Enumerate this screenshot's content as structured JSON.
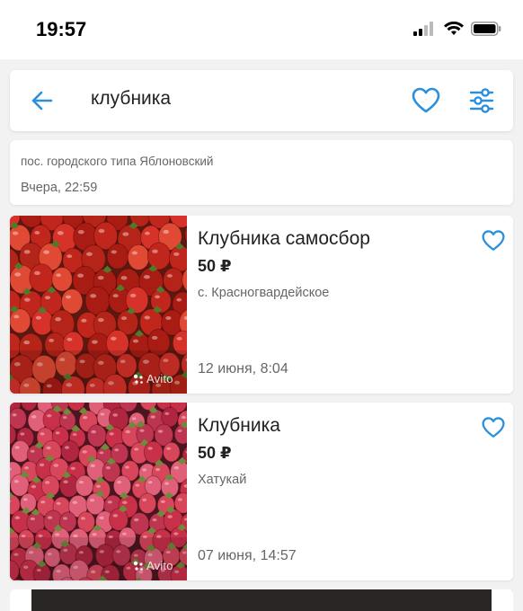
{
  "status_bar": {
    "time": "19:57"
  },
  "search": {
    "query": "клубника"
  },
  "info": {
    "location": "пос. городского типа Яблоновский",
    "date": "Вчера, 22:59"
  },
  "listings": [
    {
      "title": "Клубника самосбор",
      "price": "50 ₽",
      "place": "с. Красногвардейское",
      "date": "12 июня, 8:04",
      "watermark": "Avito"
    },
    {
      "title": "Клубника",
      "price": "50 ₽",
      "place": "Хатукай",
      "date": "07 июня, 14:57",
      "watermark": "Avito"
    }
  ],
  "colors": {
    "accent": "#2a8fdc",
    "background": "#f2f2f2",
    "card": "#ffffff"
  },
  "icons": [
    "back-arrow-icon",
    "heart-icon",
    "filter-icon",
    "signal-icon",
    "wifi-icon",
    "battery-icon"
  ]
}
